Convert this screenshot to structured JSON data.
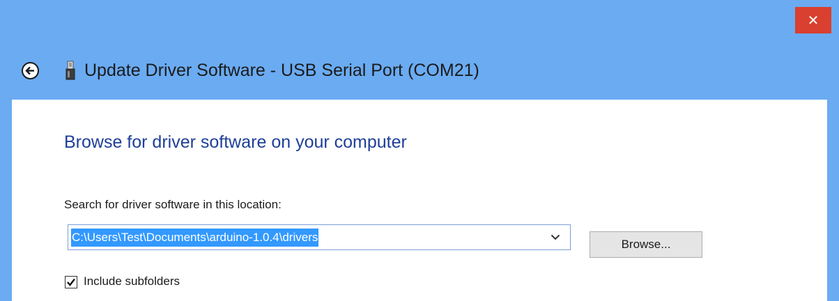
{
  "window": {
    "title": "Update Driver Software - USB Serial Port (COM21)",
    "close_glyph": "✕",
    "titlebar_color": "#6aabf2",
    "close_color": "#d9402f"
  },
  "icons": {
    "back": "back-arrow-icon",
    "device": "usb-device-icon",
    "close": "close-icon",
    "dropdown": "chevron-down-icon",
    "checkmark": "checkmark-icon"
  },
  "main": {
    "heading": "Browse for driver software on your computer",
    "heading_color": "#1f3f99",
    "search_label": "Search for driver software in this location:",
    "path_value": "C:\\Users\\Test\\Documents\\arduino-1.0.4\\drivers",
    "browse_label": "Browse...",
    "include_subfolders_label": "Include subfolders",
    "include_subfolders_checked": true
  }
}
